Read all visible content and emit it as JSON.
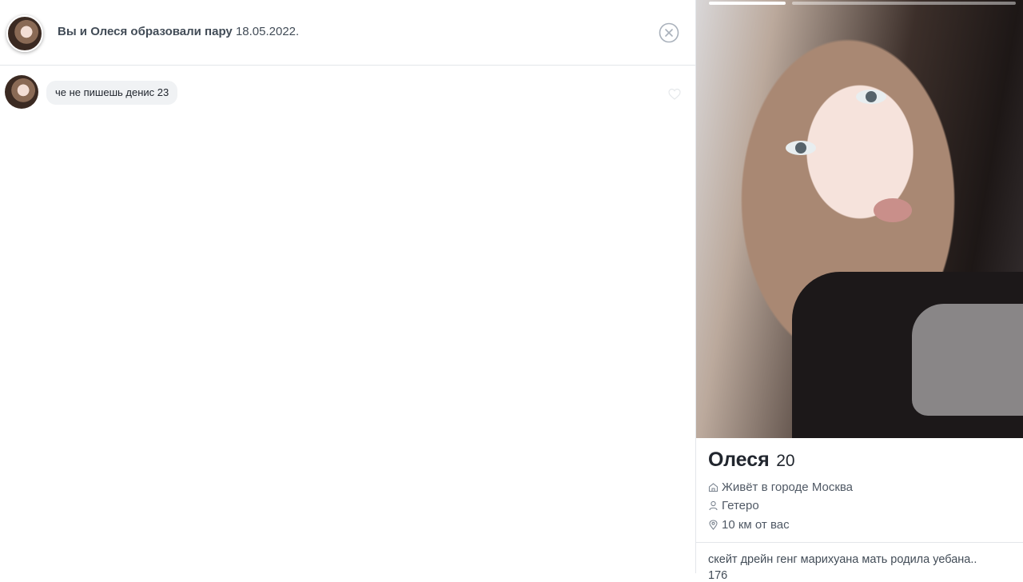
{
  "match": {
    "text_bold": "Вы и Олеся образовали пару",
    "date": "18.05.2022."
  },
  "messages": [
    {
      "text": "че не пишешь денис 23"
    }
  ],
  "profile": {
    "name": "Олеся",
    "age": "20",
    "city": "Живёт в городе Москва",
    "orientation": "Гетеро",
    "distance": "10 км от вас",
    "bio": "скейт дрейн генг марихуана мать родила уебана..",
    "bio_cut": "176"
  },
  "icons": {
    "close": "close-circle-icon",
    "like": "heart-icon",
    "city": "house-icon",
    "orientation": "person-icon",
    "distance": "location-pin-icon"
  },
  "colors": {
    "border": "#e3e6ea",
    "bubble": "#f0f2f4",
    "text": "#21262e"
  }
}
